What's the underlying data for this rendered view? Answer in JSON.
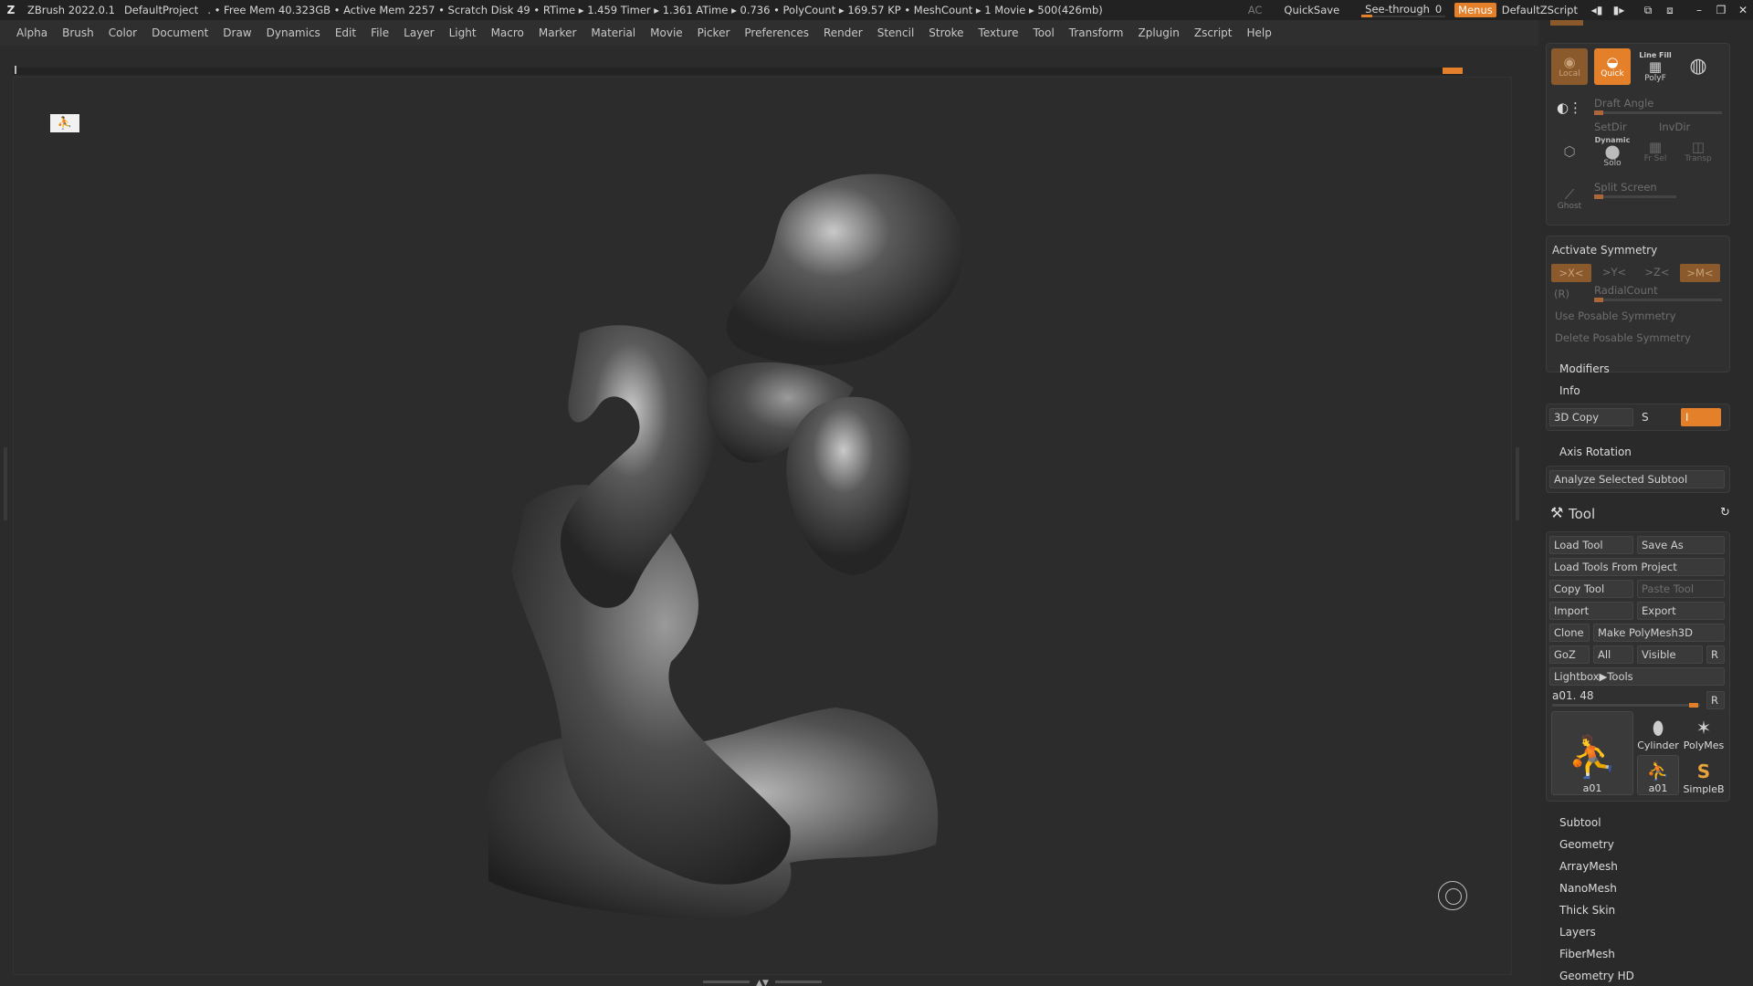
{
  "titlebar": {
    "app": "ZBrush 2022.0.1",
    "project": "DefaultProject",
    "stats": ". • Free Mem 40.323GB • Active Mem 2257 • Scratch Disk 49 •  RTime ▸ 1.459 Timer ▸ 1.361 ATime ▸ 0.736 • PolyCount ▸ 169.57 KP  • MeshCount ▸ 1  Movie ▸ 500(426mb)",
    "ac": "AC",
    "quicksave": "QuickSave",
    "seethrough": "See-through",
    "seethrough_value": "0",
    "menus": "Menus",
    "script": "DefaultZScript"
  },
  "menubar": [
    "Alpha",
    "Brush",
    "Color",
    "Document",
    "Draw",
    "Dynamics",
    "Edit",
    "File",
    "Layer",
    "Light",
    "Macro",
    "Marker",
    "Material",
    "Movie",
    "Picker",
    "Preferences",
    "Render",
    "Stencil",
    "Stroke",
    "Texture",
    "Tool",
    "Transform",
    "Zplugin",
    "Zscript",
    "Help"
  ],
  "colors": {
    "accent": "#e47f2a",
    "panel": "#303030",
    "canvas": "#2c2c2c"
  },
  "canvas": {
    "badge_icon": "figure-icon"
  },
  "panel": {
    "top_icons": {
      "local": "Local",
      "quick": "Quick",
      "linefill": "Line Fill",
      "polyf": "PolyF"
    },
    "draft_angle": "Draft Angle",
    "setdir": "SetDir",
    "invdir": "InvDir",
    "dynamic": "Dynamic",
    "solo": "Solo",
    "frsel": "Fr Sel",
    "transp": "Transp",
    "ghost": "Ghost",
    "split_screen": "Split Screen",
    "activate_symmetry": "Activate Symmetry",
    "sym_x": ">X<",
    "sym_y": ">Y<",
    "sym_z": ">Z<",
    "sym_m": ">M<",
    "sym_r": "(R)",
    "radial_count": "RadialCount",
    "use_posable": "Use Posable Symmetry",
    "delete_posable": "Delete Posable Symmetry",
    "modifiers": "Modifiers",
    "info": "Info",
    "copy3d": "3D Copy",
    "copy3d_s": "S",
    "copy3d_i": "I",
    "axis_rotation": "Axis Rotation",
    "analyze": "Analyze Selected Subtool",
    "tool_title": "Tool",
    "load_tool": "Load Tool",
    "save_as": "Save As",
    "load_from_project": "Load Tools From Project",
    "copy_tool": "Copy Tool",
    "paste_tool": "Paste Tool",
    "import": "Import",
    "export": "Export",
    "clone": "Clone",
    "make_polymesh": "Make PolyMesh3D",
    "goz": "GoZ",
    "all": "All",
    "visible": "Visible",
    "r": "R",
    "lightbox_tools": "Lightbox▶Tools",
    "tool_name": "a01. 48",
    "thumbs": {
      "main": "a01",
      "cylinder": "Cylinder",
      "polymesh": "PolyMes",
      "small": "a01",
      "simple": "SimpleB"
    },
    "sections": [
      "Subtool",
      "Geometry",
      "ArrayMesh",
      "NanoMesh",
      "Thick Skin",
      "Layers",
      "FiberMesh",
      "Geometry HD"
    ]
  }
}
